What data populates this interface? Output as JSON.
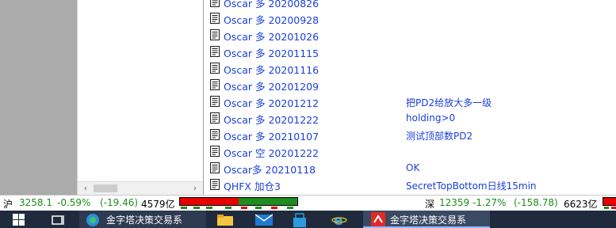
{
  "list": [
    {
      "name": "Oscar 多 20200826",
      "note": ""
    },
    {
      "name": "Oscar 多 20200928",
      "note": ""
    },
    {
      "name": "Oscar 多 20201026",
      "note": ""
    },
    {
      "name": "Oscar 多 20201115",
      "note": ""
    },
    {
      "name": "Oscar 多 20201116",
      "note": ""
    },
    {
      "name": "Oscar 多 20201209",
      "note": ""
    },
    {
      "name": "Oscar 多 20201212",
      "note": "把PD2给放大多一级"
    },
    {
      "name": "Oscar 多 20201222",
      "note": "holding>0"
    },
    {
      "name": "Oscar 多 20210107",
      "note": "测试顶部数PD2"
    },
    {
      "name": "Oscar 空 20201222",
      "note": ""
    },
    {
      "name": "Oscar多 20210118",
      "note": "OK"
    },
    {
      "name": "QHFX 加仓3",
      "note": "SecretTopBottom日线15min"
    }
  ],
  "status": {
    "sh_label": "沪",
    "sh_index": "3258.1",
    "sh_change_pct": "-0.59%",
    "sh_change": "(-19.46)",
    "sh_volume": "4579亿",
    "sz_label": "深",
    "sz_index": "12359",
    "sz_change_pct": "-1.27%",
    "sz_change": "(-158.78)",
    "sz_volume": "6623亿"
  },
  "taskbar": {
    "app1_label": "金字塔决策交易系",
    "app2_label": "金字塔决策交易系"
  },
  "colors": {
    "link": "#1a3fd8",
    "up_red": "#e60000",
    "down_green": "#1e8c1e",
    "taskbar_bg": "#1f2a3c"
  },
  "icons": [
    "document-icon",
    "windows-start-icon",
    "task-view-icon",
    "edge-icon",
    "file-explorer-icon",
    "mail-icon",
    "store-icon",
    "internet-explorer-icon",
    "pyramid-app-icon"
  ]
}
